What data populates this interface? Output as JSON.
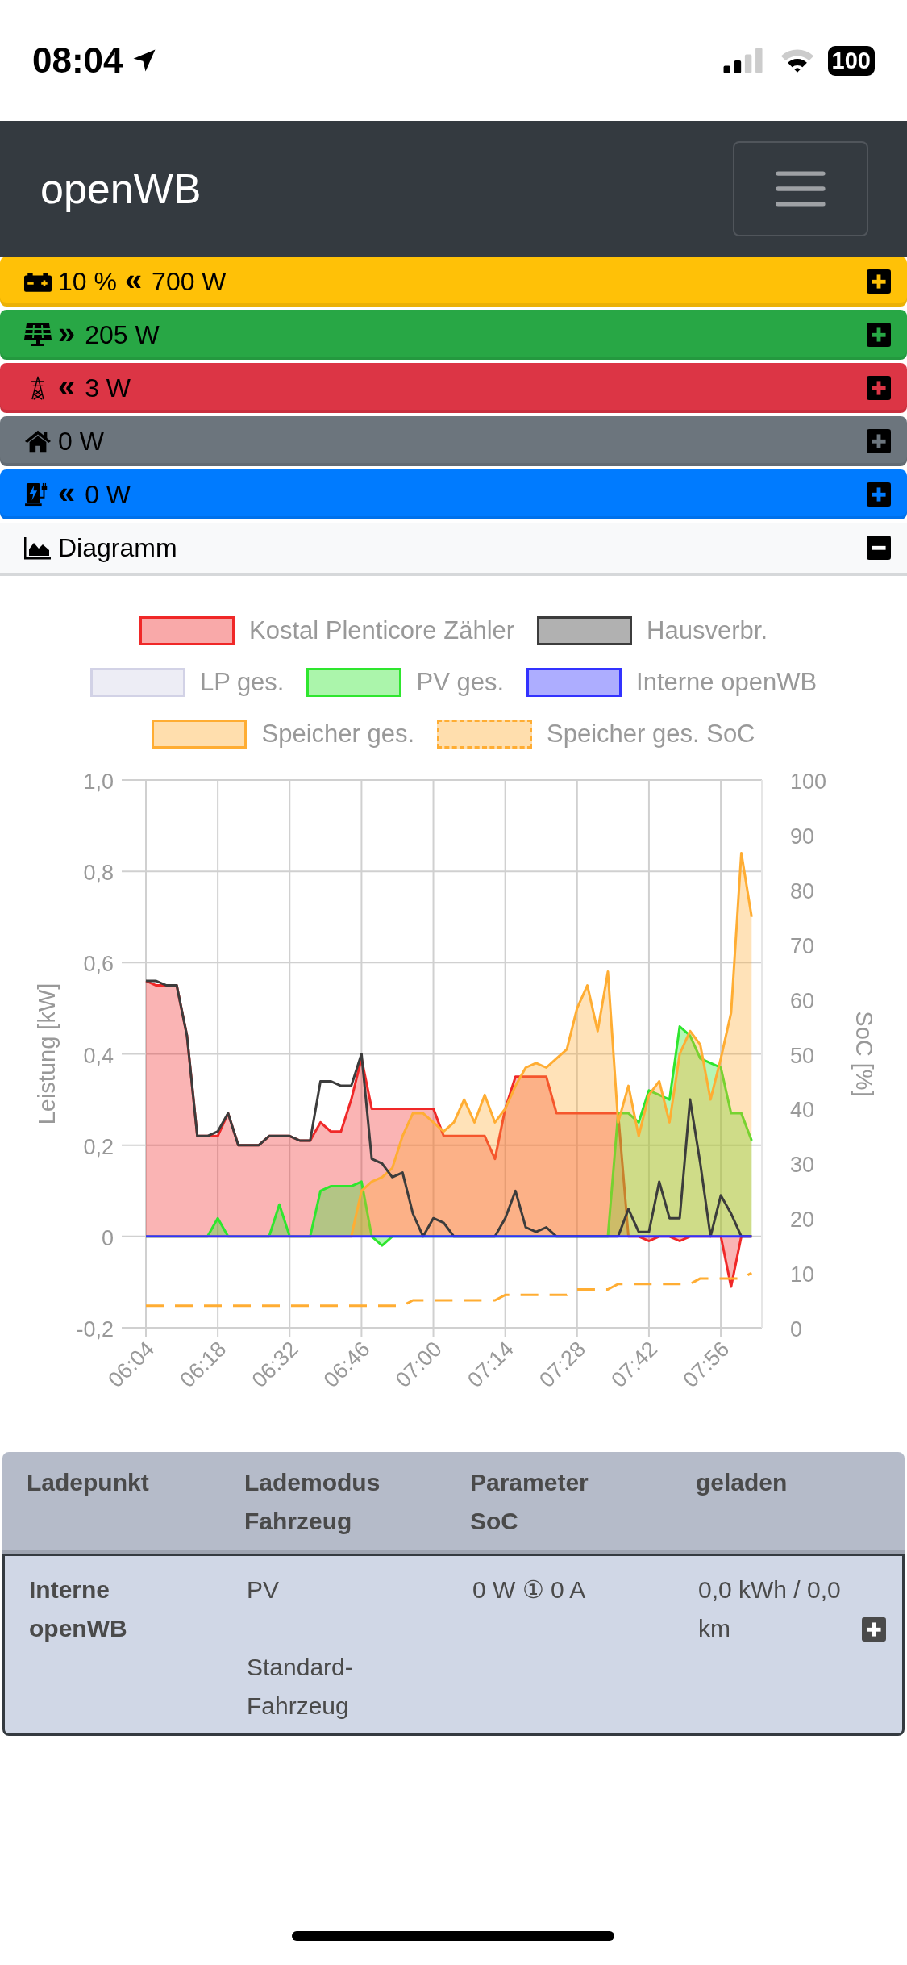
{
  "status_bar": {
    "time": "08:04",
    "battery": "100"
  },
  "navbar": {
    "brand": "openWB"
  },
  "banners": [
    {
      "kind": "battery",
      "color": "#ffc107",
      "soc": "10 %",
      "arrow": "«",
      "power": "700 W",
      "expanded": false
    },
    {
      "kind": "solar",
      "color": "#28a745",
      "arrow": "»",
      "power": "205 W",
      "expanded": false
    },
    {
      "kind": "grid",
      "color": "#dc3545",
      "arrow": "«",
      "power": "3 W",
      "expanded": false
    },
    {
      "kind": "house",
      "color": "#6c757d",
      "power": "0 W",
      "expanded": false
    },
    {
      "kind": "charger",
      "color": "#007bff",
      "arrow": "«",
      "power": "0 W",
      "expanded": false
    }
  ],
  "diagram_section": {
    "title": "Diagramm",
    "expanded": true,
    "chart_data": {
      "type": "area",
      "ylabel": "Leistung [kW]",
      "y2label": "SoC [%]",
      "xlim": [
        364,
        484
      ],
      "ylim": [
        -0.2,
        1.0
      ],
      "y2lim": [
        0,
        100
      ],
      "xticks": [
        {
          "value": 364,
          "label": "06:04"
        },
        {
          "value": 378,
          "label": "06:18"
        },
        {
          "value": 392,
          "label": "06:32"
        },
        {
          "value": 406,
          "label": "06:46"
        },
        {
          "value": 420,
          "label": "07:00"
        },
        {
          "value": 434,
          "label": "07:14"
        },
        {
          "value": 448,
          "label": "07:28"
        },
        {
          "value": 462,
          "label": "07:42"
        },
        {
          "value": 476,
          "label": "07:56"
        }
      ],
      "yticks": [
        {
          "value": -0.2,
          "label": "-0,2"
        },
        {
          "value": 0,
          "label": "0"
        },
        {
          "value": 0.2,
          "label": "0,2"
        },
        {
          "value": 0.4,
          "label": "0,4"
        },
        {
          "value": 0.6,
          "label": "0,6"
        },
        {
          "value": 0.8,
          "label": "0,8"
        },
        {
          "value": 1.0,
          "label": "1,0"
        }
      ],
      "y2ticks": [
        0,
        10,
        20,
        30,
        40,
        50,
        60,
        70,
        80,
        90,
        100
      ],
      "x": [
        364,
        366,
        368,
        370,
        372,
        374,
        376,
        378,
        380,
        382,
        384,
        386,
        388,
        390,
        392,
        394,
        396,
        398,
        400,
        402,
        404,
        406,
        408,
        410,
        412,
        414,
        416,
        418,
        420,
        422,
        424,
        426,
        428,
        430,
        432,
        434,
        436,
        438,
        440,
        442,
        444,
        446,
        448,
        450,
        452,
        454,
        456,
        458,
        460,
        462,
        464,
        466,
        468,
        470,
        472,
        474,
        476,
        478,
        480,
        482
      ],
      "grid": true,
      "legend": true,
      "series": [
        {
          "name": "Kostal Plenticore Zähler",
          "color": "#f02828",
          "values": [
            0.56,
            0.55,
            0.55,
            0.55,
            0.44,
            0.22,
            0.22,
            0.22,
            0.27,
            0.2,
            0.2,
            0.2,
            0.22,
            0.22,
            0.22,
            0.21,
            0.21,
            0.25,
            0.23,
            0.23,
            0.3,
            0.39,
            0.28,
            0.28,
            0.28,
            0.28,
            0.28,
            0.28,
            0.28,
            0.22,
            0.22,
            0.22,
            0.22,
            0.22,
            0.17,
            0.28,
            0.35,
            0.35,
            0.35,
            0.35,
            0.27,
            0.27,
            0.27,
            0.27,
            0.27,
            0.27,
            0.27,
            0,
            0,
            -0.01,
            0,
            0,
            -0.01,
            0,
            0,
            0,
            0,
            -0.11,
            0,
            0
          ]
        },
        {
          "name": "Hausverbr.",
          "type": "line",
          "color": "#3c3c3c",
          "values": [
            0.56,
            0.56,
            0.55,
            0.55,
            0.44,
            0.22,
            0.22,
            0.23,
            0.27,
            0.2,
            0.2,
            0.2,
            0.22,
            0.22,
            0.22,
            0.21,
            0.21,
            0.34,
            0.34,
            0.33,
            0.33,
            0.4,
            0.17,
            0.16,
            0.13,
            0.14,
            0.05,
            0,
            0.04,
            0.03,
            0,
            0,
            0,
            0,
            0,
            0.04,
            0.1,
            0.02,
            0.01,
            0.02,
            0,
            0,
            0,
            0,
            0,
            0,
            0,
            0.06,
            0.01,
            0.01,
            0.12,
            0.04,
            0.04,
            0.3,
            0.16,
            0,
            0.09,
            0.05,
            0,
            0
          ]
        },
        {
          "name": "LP ges.",
          "color": "#d2d2e6",
          "values": [
            null,
            null,
            null,
            null,
            null,
            null,
            null,
            null,
            null,
            null,
            null,
            null,
            null,
            null,
            null,
            null,
            null,
            null,
            null,
            null,
            null,
            null,
            null,
            null,
            null,
            null,
            null,
            null,
            null,
            null,
            null,
            null,
            null,
            null,
            null,
            null,
            null,
            null,
            null,
            null,
            null,
            null,
            null,
            null,
            null,
            null,
            null,
            null,
            null,
            null,
            null,
            null,
            null,
            null,
            null,
            null,
            null,
            null,
            null,
            null
          ]
        },
        {
          "name": "PV ges.",
          "color": "#2ee62e",
          "values": [
            0,
            0,
            0,
            0,
            0,
            0,
            0,
            0.04,
            0,
            0,
            0,
            0,
            0,
            0.07,
            0,
            0,
            0,
            0.1,
            0.11,
            0.11,
            0.11,
            0.12,
            0,
            -0.02,
            0,
            0,
            0,
            0,
            0,
            0,
            0,
            0,
            0,
            0,
            0,
            0,
            0,
            0,
            0,
            0,
            0,
            0,
            0,
            0,
            0,
            0,
            0.27,
            0.27,
            0.25,
            0.32,
            0.31,
            0.3,
            0.46,
            0.44,
            0.39,
            0.38,
            0.37,
            0.27,
            0.27,
            0.21
          ]
        },
        {
          "name": "Interne openWB",
          "type": "line",
          "color": "#3232ff",
          "values": [
            0,
            0,
            0,
            0,
            0,
            0,
            0,
            0,
            0,
            0,
            0,
            0,
            0,
            0,
            0,
            0,
            0,
            0,
            0,
            0,
            0,
            0,
            0,
            0,
            0,
            0,
            0,
            0,
            0,
            0,
            0,
            0,
            0,
            0,
            0,
            0,
            0,
            0,
            0,
            0,
            0,
            0,
            0,
            0,
            0,
            0,
            0,
            0,
            0,
            0,
            0,
            0,
            0,
            0,
            0,
            0,
            0,
            0,
            0,
            0
          ]
        },
        {
          "name": "Speicher ges.",
          "color": "#ffad33",
          "values": [
            0,
            0,
            0,
            0,
            0,
            0,
            0,
            0,
            0,
            0,
            0,
            0,
            0,
            0,
            0,
            0,
            0,
            0,
            0,
            0,
            0,
            0.1,
            0.12,
            0.13,
            0.15,
            0.22,
            0.27,
            0.27,
            0.25,
            0.23,
            0.25,
            0.3,
            0.25,
            0.31,
            0.25,
            0.28,
            0.33,
            0.37,
            0.38,
            0.37,
            0.39,
            0.41,
            0.5,
            0.55,
            0.45,
            0.58,
            0.25,
            0.33,
            0.22,
            0.31,
            0.34,
            0.25,
            0.4,
            0.45,
            0.42,
            0.3,
            0.39,
            0.49,
            0.84,
            0.7
          ]
        },
        {
          "name": "Speicher ges. SoC",
          "type": "line",
          "color": "#ffad33",
          "axis": "y2",
          "line_style": "dashed",
          "values": [
            4,
            4,
            4,
            4,
            4,
            4,
            4,
            4,
            4,
            4,
            4,
            4,
            4,
            4,
            4,
            4,
            4,
            4,
            4,
            4,
            4,
            4,
            4,
            4,
            4,
            4,
            5,
            5,
            5,
            5,
            5,
            5,
            5,
            5,
            5,
            6,
            6,
            6,
            6,
            6,
            6,
            6,
            7,
            7,
            7,
            7,
            8,
            8,
            8,
            8,
            8,
            8,
            8,
            8,
            9,
            9,
            9,
            9,
            9,
            10
          ]
        }
      ]
    }
  },
  "table": {
    "columns": [
      [
        "Ladepunkt"
      ],
      [
        "Lademodus",
        "Fahrzeug"
      ],
      [
        "Parameter",
        "SoC"
      ],
      [
        "geladen"
      ]
    ],
    "rows": [
      {
        "name": "Interne openWB",
        "mode": "PV",
        "vehicle": "Standard-Fahrzeug",
        "parameter": "0 W ① 0 A",
        "charged": "0,0 kWh / 0,0 km",
        "expanded": false
      }
    ]
  }
}
